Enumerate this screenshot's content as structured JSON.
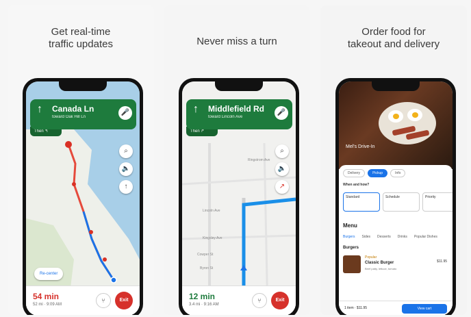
{
  "cards": [
    {
      "title_line1": "Get real-time",
      "title_line2": "traffic updates",
      "banner": {
        "street": "Canada Ln",
        "toward": "toward Oak Hill Ln",
        "then": "Then ↰"
      },
      "recenter": "Re-center",
      "eta": {
        "time": "54 min",
        "sub": "52 mi · 9:09 AM"
      },
      "exit_label": "Exit"
    },
    {
      "title_line1": "Never miss a turn",
      "title_line2": "",
      "banner": {
        "street": "Middlefield Rd",
        "toward": "toward Lincoln Ave",
        "then": "Then ↱"
      },
      "map_labels": [
        "Ringstrom Ave",
        "Lincoln Ave",
        "Kingsley Ave",
        "Cowper St",
        "Byron St"
      ],
      "eta": {
        "time": "12 min",
        "sub": "3.4 mi · 9:16 AM"
      },
      "exit_label": "Exit"
    },
    {
      "title_line1": "Order food for",
      "title_line2": "takeout and delivery",
      "hero_text": "Mel's Drive-In",
      "tabs": [
        "Delivery",
        "Pickup",
        "Info"
      ],
      "when_label": "When and how?",
      "options": [
        "Standard",
        "Schedule",
        "Priority"
      ],
      "menu_title": "Menu",
      "menu_tabs": [
        "Burgers",
        "Sides",
        "Desserts",
        "Drinks",
        "Popular Dishes"
      ],
      "section": "Burgers",
      "item": {
        "badge": "Popular",
        "name": "Classic Burger",
        "desc": "Beef patty, lettuce, tomato",
        "price": "$11.95"
      },
      "cart_total": "1 item · $11.95",
      "checkout": "View cart"
    }
  ]
}
